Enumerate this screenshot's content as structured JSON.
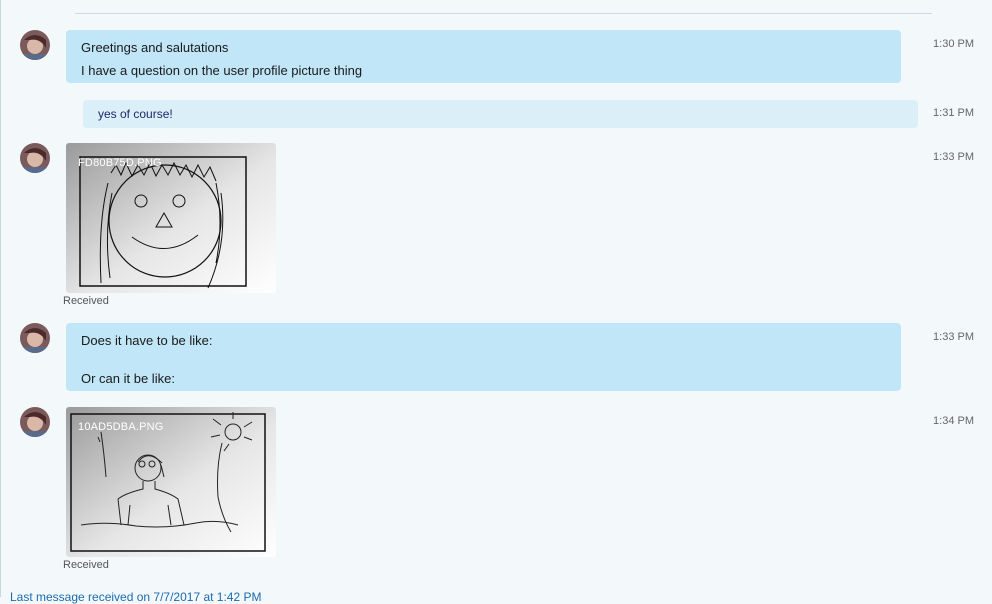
{
  "messages": [
    {
      "type": "incoming",
      "lines": [
        "Greetings and salutations",
        "I have a question on the user profile picture thing"
      ],
      "time": "1:30 PM"
    },
    {
      "type": "outgoing",
      "text": "yes of course!",
      "time": "1:31 PM"
    },
    {
      "type": "image",
      "filename": "FD80B75D.PNG",
      "status": "Received",
      "time": "1:33 PM"
    },
    {
      "type": "incoming",
      "lines": [
        "Does it have to be like:",
        "Or can it be like:"
      ],
      "time": "1:33 PM"
    },
    {
      "type": "image",
      "filename": "10AD5DBA.PNG",
      "status": "Received",
      "time": "1:34 PM"
    }
  ],
  "footer": {
    "text": "Last message received on 7/7/2017 at 1:42 PM"
  }
}
